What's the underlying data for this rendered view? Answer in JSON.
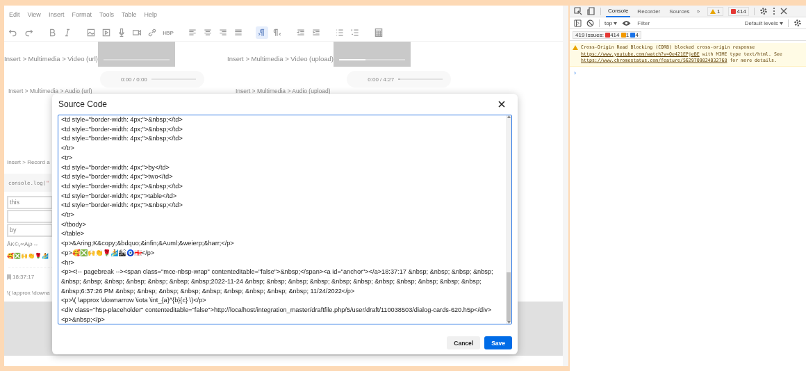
{
  "editor": {
    "menu": [
      "Edit",
      "View",
      "Insert",
      "Format",
      "Tools",
      "Table",
      "Help"
    ],
    "toolbar": [
      {
        "kind": "undo",
        "selected": false
      },
      {
        "kind": "redo",
        "selected": false
      },
      {
        "kind": "bold",
        "selected": false
      },
      {
        "kind": "italic",
        "selected": false
      },
      {
        "kind": "image",
        "selected": false
      },
      {
        "kind": "media",
        "selected": false
      },
      {
        "kind": "mic",
        "selected": false
      },
      {
        "kind": "camera",
        "selected": false
      },
      {
        "kind": "link",
        "selected": false
      },
      {
        "kind": "h5p",
        "label": "H5P",
        "selected": false
      },
      {
        "kind": "align-left",
        "selected": false
      },
      {
        "kind": "align-center",
        "selected": false
      },
      {
        "kind": "align-right",
        "selected": false
      },
      {
        "kind": "justify",
        "selected": false
      },
      {
        "kind": "ltr",
        "selected": true
      },
      {
        "kind": "rtl",
        "selected": false
      },
      {
        "kind": "outdent",
        "selected": false
      },
      {
        "kind": "indent",
        "selected": false
      },
      {
        "kind": "bullets",
        "selected": false
      },
      {
        "kind": "numbers",
        "selected": false
      },
      {
        "kind": "calculator",
        "selected": false
      }
    ],
    "videos": [
      {
        "caption": "Insert > Multimedia > Video (url)",
        "level": 0
      },
      {
        "caption": "Insert > Multimedia > Video (upload)",
        "level": 0.4
      }
    ],
    "audios": [
      {
        "caption": "Insert > Multimedia > Audio (url)",
        "time": "0:00 / 0:00",
        "level": 0
      },
      {
        "caption": "Insert > Multimedia > Audio (upload)",
        "time": "0:00 / 4:27",
        "level": 0.05
      }
    ],
    "record_caption": "Insert > Record a",
    "code_snippet": {
      "call": "console.log(",
      "quote": "\""
    },
    "table_rows": [
      {
        "cell": "this"
      },
      {},
      {
        "cell": "by"
      }
    ],
    "special_chars": "ÅK©„∞Ä℘↔",
    "emoji": "🥰❎🙌👏🌹🏄",
    "timestamp": "18:37:17",
    "formula": "\\( \\approx \\downa"
  },
  "dialog": {
    "title": "Source Code",
    "lines": [
      "<td style=\"border-width: 4px;\">&nbsp;</td>",
      "<td style=\"border-width: 4px;\">&nbsp;</td>",
      "<td style=\"border-width: 4px;\">&nbsp;</td>",
      "</tr>",
      "<tr>",
      "<td style=\"border-width: 4px;\">by</td>",
      "<td style=\"border-width: 4px;\">two</td>",
      "<td style=\"border-width: 4px;\">&nbsp;</td>",
      "<td style=\"border-width: 4px;\">table</td>",
      "<td style=\"border-width: 4px;\">&nbsp;</td>",
      "</tr>",
      "</tbody>",
      "</table>",
      "<p>&Aring;K&copy;&bdquo;&infin;&Auml;&weierp;&harr;</p>",
      "<p>🥰❎🙌👏🌹🏄🏙🧿🇬🇪</p>",
      "<hr>",
      "<p><!-- pagebreak --><span class=\"mce-nbsp-wrap\" contenteditable=\"false\">&nbsp;</span><a id=\"anchor\"></a>18:37:17 &nbsp; &nbsp; &nbsp; &nbsp; &nbsp; &nbsp; &nbsp; &nbsp; &nbsp; &nbsp; &nbsp;2022-11-24 &nbsp; &nbsp; &nbsp; &nbsp; &nbsp; &nbsp; &nbsp; &nbsp; &nbsp; &nbsp; &nbsp; &nbsp;6:37:26 PM &nbsp; &nbsp; &nbsp; &nbsp; &nbsp; &nbsp; &nbsp; &nbsp; &nbsp; 11/24/2022</p>",
      "<p>\\( \\approx \\downarrow \\iota \\int_{a}^{b}{c} \\)</p>",
      "<div class=\"h5p-placeholder\" contenteditable=\"false\">http://localhost/integration_master/draftfile.php/5/user/draft/110038503/dialog-cards-620.h5p</div>",
      "<p>&nbsp;</p>"
    ],
    "buttons": [
      {
        "label": "Cancel",
        "kind": "secondary"
      },
      {
        "label": "Save",
        "kind": "primary"
      }
    ]
  },
  "devtools": {
    "tabs": [
      {
        "label": "Console",
        "selected": true
      },
      {
        "label": "Recorder",
        "selected": false
      },
      {
        "label": "Sources",
        "selected": false
      }
    ],
    "more": "»",
    "warning_count": "1",
    "error_count": "414",
    "context": "top",
    "filter": {
      "placeholder": "Filter"
    },
    "levels": "Default levels",
    "issues": {
      "label": "419 Issues:",
      "errors": "414",
      "warnings": "1",
      "infos": "4"
    },
    "messages": [
      {
        "kind": "warning",
        "parts": [
          {
            "text": "Cross-Origin Read Blocking (CORB) blocked cross-origin response "
          },
          {
            "link": "https://www.youtube.com/watch?v=Oe421EPjeBE"
          },
          {
            "text": " with MIME type text/html. See "
          },
          {
            "link": "https://www.chromestatus.com/feature/5629709824032768"
          },
          {
            "text": " for more details."
          }
        ]
      }
    ],
    "prompt": "›"
  }
}
